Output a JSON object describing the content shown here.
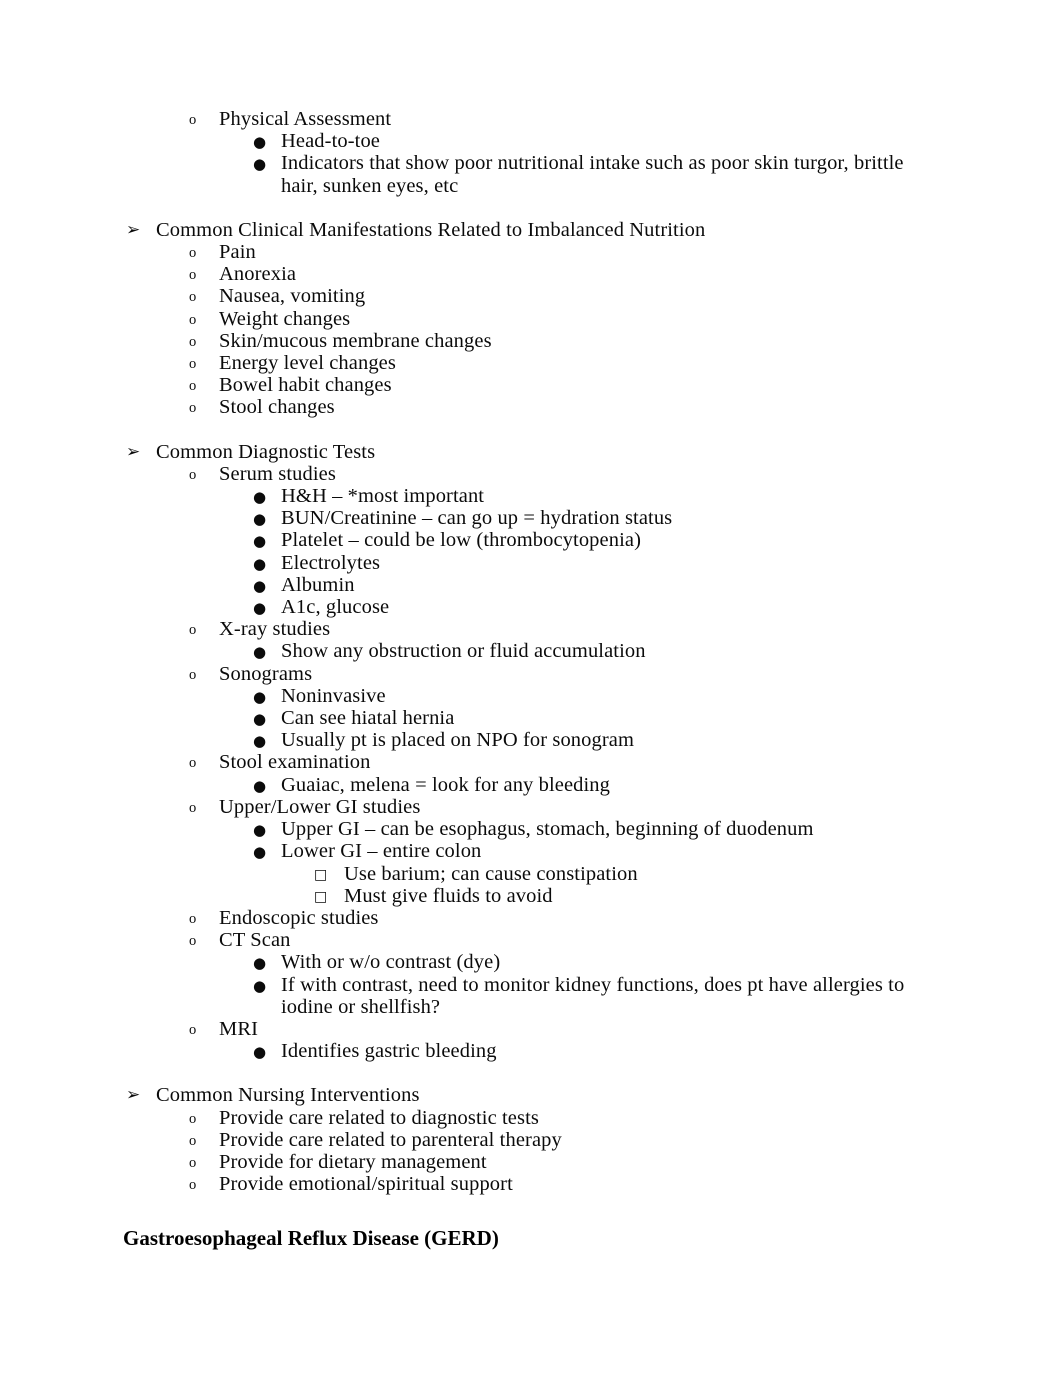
{
  "document": {
    "bullets": {
      "level1": "➢",
      "level2": "o",
      "level3": "●",
      "level4": "□"
    },
    "blocks": [
      {
        "id": "physical-assessment",
        "items": [
          {
            "level": 2,
            "text": "Physical Assessment"
          },
          {
            "level": 3,
            "text": "Head-to-toe"
          },
          {
            "level": 3,
            "text": "Indicators that show poor nutritional intake such as poor skin turgor, brittle hair, sunken eyes, etc"
          }
        ]
      },
      {
        "id": "common-clinical-manifestations",
        "items": [
          {
            "level": 1,
            "text": "Common Clinical Manifestations Related to Imbalanced Nutrition"
          },
          {
            "level": 2,
            "text": "Pain"
          },
          {
            "level": 2,
            "text": "Anorexia"
          },
          {
            "level": 2,
            "text": "Nausea, vomiting"
          },
          {
            "level": 2,
            "text": "Weight changes"
          },
          {
            "level": 2,
            "text": "Skin/mucous membrane changes"
          },
          {
            "level": 2,
            "text": "Energy level changes"
          },
          {
            "level": 2,
            "text": "Bowel habit changes"
          },
          {
            "level": 2,
            "text": "Stool changes"
          }
        ]
      },
      {
        "id": "common-diagnostic-tests",
        "items": [
          {
            "level": 1,
            "text": "Common Diagnostic Tests"
          },
          {
            "level": 2,
            "text": "Serum studies"
          },
          {
            "level": 3,
            "text": "H&H – *most important"
          },
          {
            "level": 3,
            "text": "BUN/Creatinine – can go up = hydration status"
          },
          {
            "level": 3,
            "text": "Platelet – could be low (thrombocytopenia)"
          },
          {
            "level": 3,
            "text": "Electrolytes"
          },
          {
            "level": 3,
            "text": "Albumin"
          },
          {
            "level": 3,
            "text": "A1c, glucose"
          },
          {
            "level": 2,
            "text": "X-ray studies"
          },
          {
            "level": 3,
            "text": "Show any obstruction or fluid accumulation"
          },
          {
            "level": 2,
            "text": "Sonograms"
          },
          {
            "level": 3,
            "text": "Noninvasive"
          },
          {
            "level": 3,
            "text": "Can see hiatal hernia"
          },
          {
            "level": 3,
            "text": "Usually pt is placed on NPO for sonogram"
          },
          {
            "level": 2,
            "text": "Stool examination"
          },
          {
            "level": 3,
            "text": "Guaiac, melena = look for any bleeding"
          },
          {
            "level": 2,
            "text": "Upper/Lower GI studies"
          },
          {
            "level": 3,
            "text": "Upper GI – can be esophagus, stomach, beginning of duodenum"
          },
          {
            "level": 3,
            "text": "Lower GI – entire colon"
          },
          {
            "level": 4,
            "text": "Use barium; can cause constipation"
          },
          {
            "level": 4,
            "text": "Must give fluids to avoid"
          },
          {
            "level": 2,
            "text": "Endoscopic studies"
          },
          {
            "level": 2,
            "text": "CT Scan"
          },
          {
            "level": 3,
            "text": "With or w/o contrast (dye)"
          },
          {
            "level": 3,
            "text": "If with contrast, need to monitor kidney functions, does pt have allergies to iodine or shellfish?"
          },
          {
            "level": 2,
            "text": "MRI"
          },
          {
            "level": 3,
            "text": "Identifies gastric bleeding"
          }
        ]
      },
      {
        "id": "common-nursing-interventions",
        "items": [
          {
            "level": 1,
            "text": "Common Nursing Interventions"
          },
          {
            "level": 2,
            "text": "Provide care related to diagnostic tests"
          },
          {
            "level": 2,
            "text": "Provide care related to parenteral therapy"
          },
          {
            "level": 2,
            "text": "Provide for dietary management"
          },
          {
            "level": 2,
            "text": "Provide emotional/spiritual support"
          }
        ]
      }
    ],
    "heading": "Gastroesophageal Reflux Disease (GERD)"
  }
}
